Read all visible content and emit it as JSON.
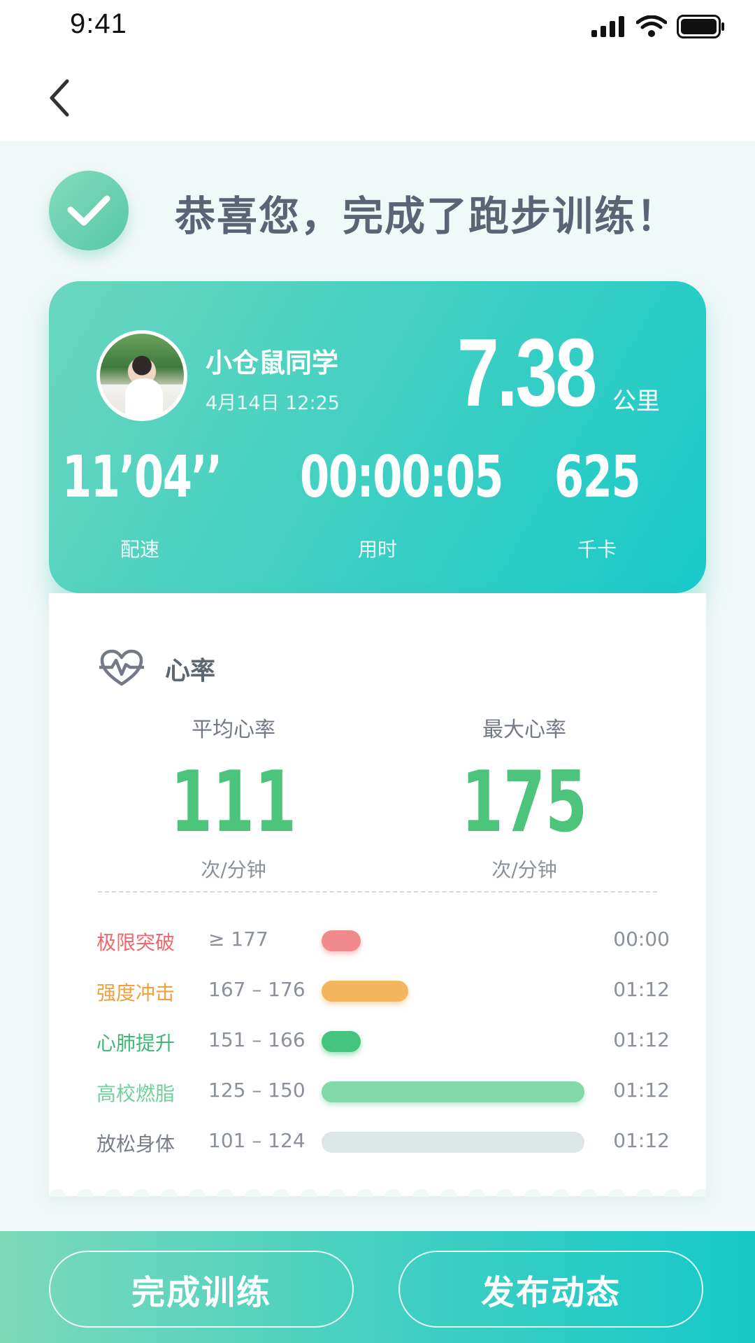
{
  "status_bar": {
    "time": "9:41"
  },
  "congrats": {
    "message": "恭喜您，完成了跑步训练！"
  },
  "summary": {
    "user_name": "小仓鼠同学",
    "datetime": "4月14日 12:25",
    "distance": "7.38",
    "distance_unit": "公里",
    "stats": [
      {
        "value": "11’04’’",
        "label": "配速"
      },
      {
        "value": "00:00:05",
        "label": "用时"
      },
      {
        "value": "625",
        "label": "千卡"
      }
    ]
  },
  "heart_rate": {
    "title": "心率",
    "average": {
      "label": "平均心率",
      "value": "111",
      "unit": "次/分钟"
    },
    "max": {
      "label": "最大心率",
      "value": "175",
      "unit": "次/分钟"
    },
    "zones": [
      {
        "name": "极限突破",
        "range": "≥ 177",
        "time": "00:00",
        "color": "#f08a8c",
        "fill": 0.15
      },
      {
        "name": "强度冲击",
        "range": "167 – 176",
        "time": "01:12",
        "color": "#f3b55d",
        "fill": 0.33
      },
      {
        "name": "心肺提升",
        "range": "151 – 166",
        "time": "01:12",
        "color": "#45c47f",
        "fill": 0.15
      },
      {
        "name": "高校燃脂",
        "range": "125 – 150",
        "time": "01:12",
        "color": "#82d8a8",
        "fill": 1.0
      },
      {
        "name": "放松身体",
        "range": "101 – 124",
        "time": "01:12",
        "color": "#dde6e6",
        "fill": 1.0
      }
    ]
  },
  "actions": {
    "finish_label": "完成训练",
    "publish_label": "发布动态"
  },
  "colors": {
    "accent_green": "#4cc47c",
    "card_gradient_start": "#6ad6bd",
    "card_gradient_end": "#18c9c9",
    "zone_name_colors": [
      "#ec6a6e",
      "#f0a13c",
      "#3cb877",
      "#6fd09a",
      "#777e88"
    ]
  }
}
